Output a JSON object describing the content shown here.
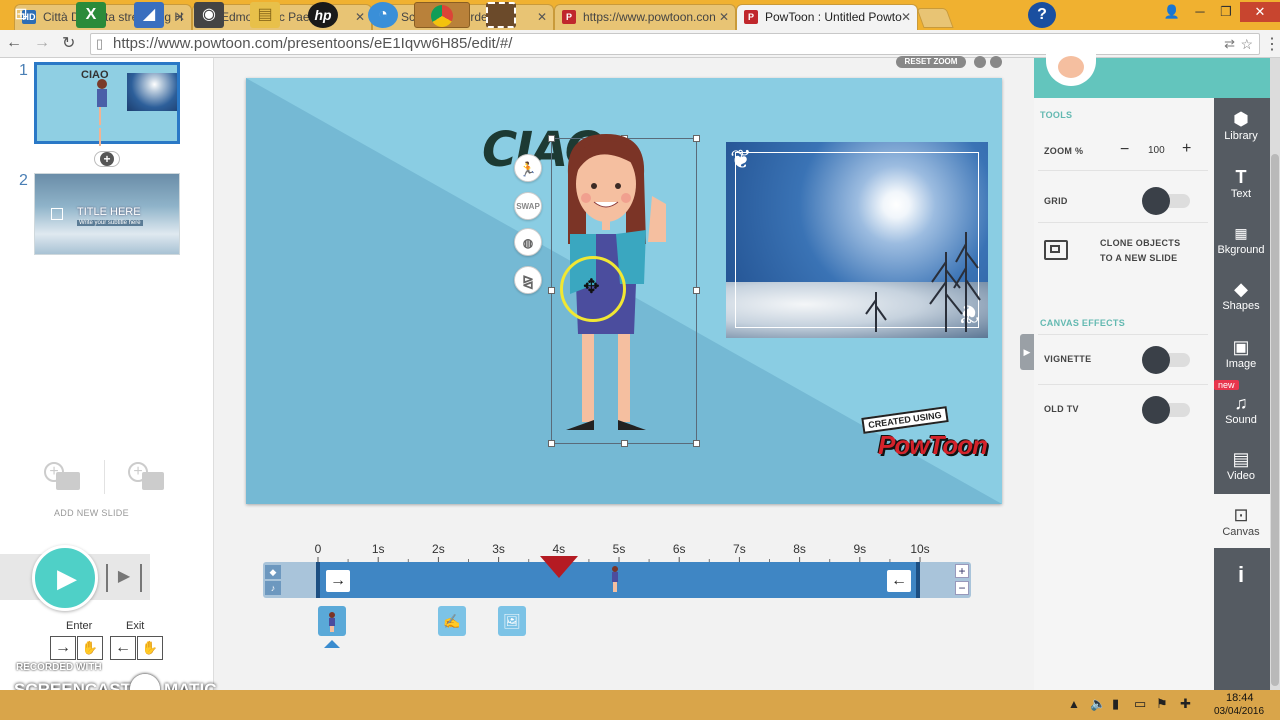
{
  "browser": {
    "tabs": [
      {
        "label": "Città Di Carta streaming H",
        "favicon": "HD",
        "color": "#2d6db5"
      },
      {
        "label": "Edmodo | Ic Paese",
        "favicon": "e",
        "color": "#3a7bd5"
      },
      {
        "label": "Screen Recorder",
        "favicon": "●",
        "color": "#8aa"
      },
      {
        "label": "https://www.powtoon.con",
        "favicon": "P",
        "color": "#c0272d"
      },
      {
        "label": "PowToon : Untitled Powto",
        "favicon": "P",
        "color": "#c0272d"
      }
    ],
    "url": "https://www.powtoon.com/presentoons/eE1Iqvw6H85/edit/#/"
  },
  "slides": [
    {
      "number": "1",
      "thumb_text": "CIAO"
    },
    {
      "number": "2",
      "thumb_title": "TITLE HERE",
      "thumb_subtitle": "Write your subtitle here"
    }
  ],
  "left_panel": {
    "add_new_slide": "ADD NEW SLIDE",
    "enter_label": "Enter",
    "exit_label": "Exit"
  },
  "canvas": {
    "heading_text": "CIAO",
    "reset_zoom": "RESET ZOOM",
    "swap_label": "SWAP",
    "badge_created": "CREATED USING",
    "badge_brand": "PowToon"
  },
  "tools": {
    "header": "TOOLS",
    "zoom_label": "ZOOM %",
    "zoom_value": "100",
    "zoom_minus": "−",
    "zoom_plus": "+",
    "grid_label": "GRID",
    "clone_label_line1": "CLONE OBJECTS",
    "clone_label_line2": "TO A NEW SLIDE",
    "canvas_effects_header": "CANVAS EFFECTS",
    "vignette_label": "VIGNETTE",
    "oldtv_label": "OLD TV"
  },
  "sidebar": {
    "items": [
      {
        "label": "Library",
        "icon": "cube-icon"
      },
      {
        "label": "Text",
        "icon": "text-icon"
      },
      {
        "label": "Bkground",
        "icon": "background-icon"
      },
      {
        "label": "Shapes",
        "icon": "shapes-icon"
      },
      {
        "label": "Image",
        "icon": "image-icon"
      },
      {
        "label": "Sound",
        "icon": "music-icon",
        "badge": "new"
      },
      {
        "label": "Video",
        "icon": "video-icon"
      },
      {
        "label": "Canvas",
        "icon": "canvas-icon"
      }
    ],
    "info": "i"
  },
  "timeline": {
    "ticks": [
      "0",
      "1s",
      "2s",
      "3s",
      "4s",
      "5s",
      "6s",
      "7s",
      "8s",
      "9s",
      "10s"
    ],
    "playhead_seconds": 4,
    "plus": "+",
    "minus": "−"
  },
  "watermark": {
    "line1": "RECORDED WITH",
    "line2": "SCREENCAST",
    "line3": "MATIC"
  },
  "taskbar": {
    "time": "18:44",
    "date": "03/04/2016"
  }
}
